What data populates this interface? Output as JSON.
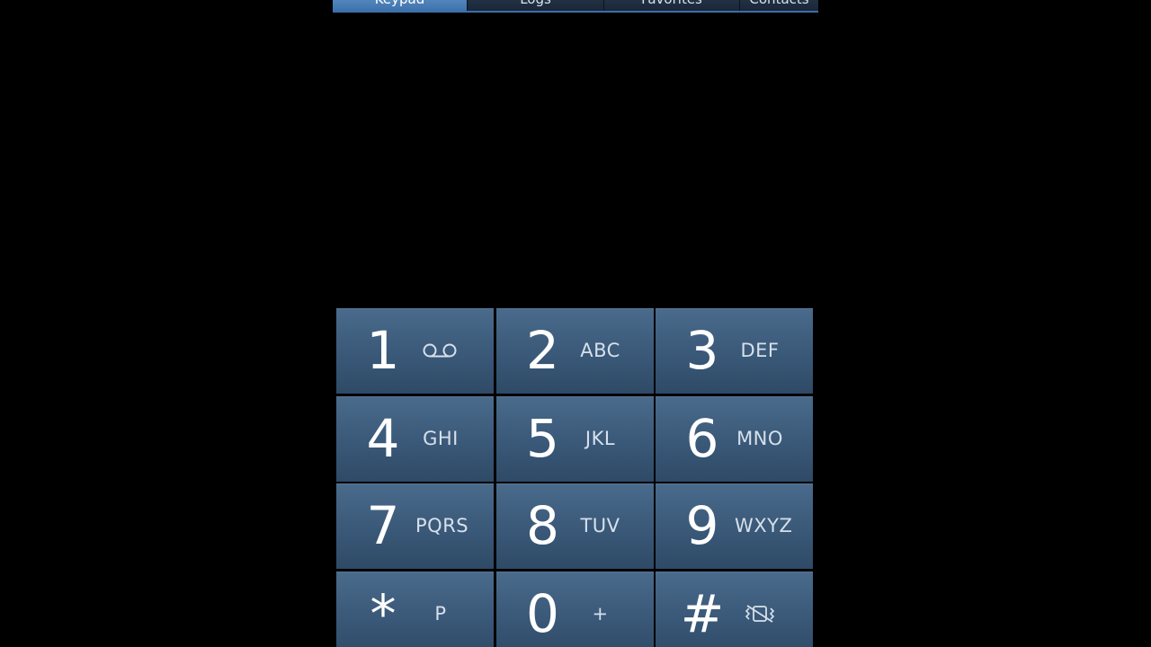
{
  "tabs": [
    {
      "label": "Keypad"
    },
    {
      "label": "Logs"
    },
    {
      "label": "Favorites"
    },
    {
      "label": "Contacts"
    }
  ],
  "display": {
    "number": ""
  },
  "keypad": {
    "keys": [
      {
        "digit": "1",
        "sub": "",
        "icon": "voicemail-icon"
      },
      {
        "digit": "2",
        "sub": "ABC"
      },
      {
        "digit": "3",
        "sub": "DEF"
      },
      {
        "digit": "4",
        "sub": "GHI"
      },
      {
        "digit": "5",
        "sub": "JKL"
      },
      {
        "digit": "6",
        "sub": "MNO"
      },
      {
        "digit": "7",
        "sub": "PQRS"
      },
      {
        "digit": "8",
        "sub": "TUV"
      },
      {
        "digit": "9",
        "sub": "WXYZ"
      },
      {
        "digit": "*",
        "sub": "P"
      },
      {
        "digit": "0",
        "sub": "+"
      },
      {
        "digit": "#",
        "sub": "",
        "icon": "vibrate-mute-icon"
      }
    ]
  },
  "colors": {
    "background": "#000000",
    "key_top": "#4a6b8c",
    "key_bottom": "#2e4a66",
    "tab_active": "#5a8cc2",
    "tab_accent": "#3a6ea8"
  }
}
